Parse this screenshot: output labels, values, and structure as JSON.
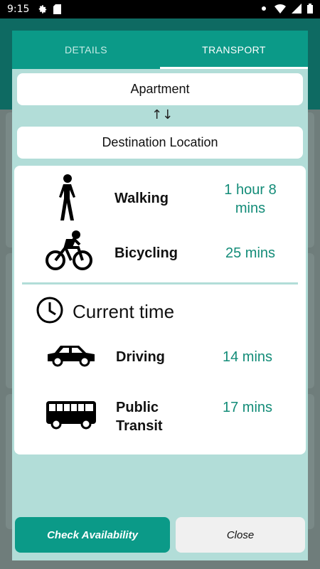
{
  "status_bar": {
    "time": "9:15",
    "left_icons": [
      "gear-icon",
      "sd-card-icon"
    ],
    "right_icons": [
      "notch-icon",
      "wifi-icon",
      "signal-icon",
      "battery-icon"
    ]
  },
  "tabs": [
    {
      "label": "DETAILS",
      "active": false
    },
    {
      "label": "TRANSPORT",
      "active": true
    }
  ],
  "origin": {
    "value": "Apartment"
  },
  "swap_icon": "↑↓",
  "destination": {
    "value": "Destination Location"
  },
  "walk_bike": [
    {
      "mode": "Walking",
      "time_line1": "1 hour 8",
      "time_line2": "mins",
      "icon": "walking-icon"
    },
    {
      "mode": "Bicycling",
      "time": "25 mins",
      "icon": "bicycle-icon"
    }
  ],
  "time_selector": {
    "label": "Current time",
    "icon": "clock-icon"
  },
  "motor": [
    {
      "mode": "Driving",
      "time": "14 mins",
      "icon": "car-icon"
    },
    {
      "mode_line1": "Public",
      "mode_line2": "Transit",
      "time": "17 mins",
      "icon": "bus-icon"
    }
  ],
  "actions": {
    "check_label": "Check Availability",
    "close_label": "Close"
  },
  "colors": {
    "accent": "#0b9a88",
    "time_text": "#138c78",
    "dialog_bg": "#b2ddd8"
  }
}
